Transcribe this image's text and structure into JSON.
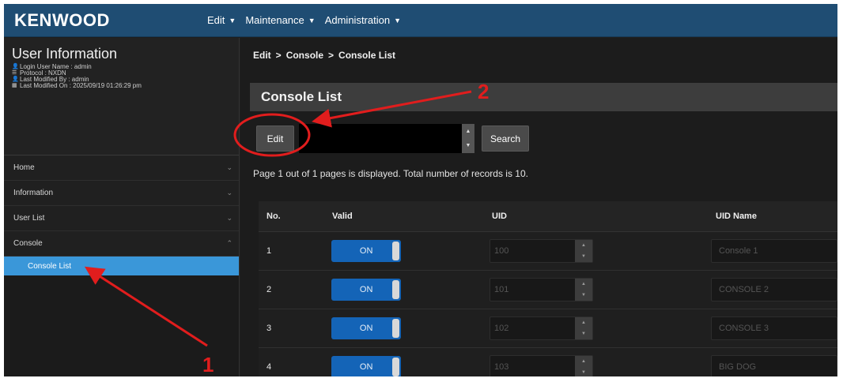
{
  "brand": {
    "name": "KENWOOD"
  },
  "nav": {
    "items": [
      "Edit",
      "Maintenance",
      "Administration"
    ]
  },
  "user_info": {
    "title": "User Information",
    "lines": [
      "Login User Name : admin",
      "Protocol : NXDN",
      "Last Modified By : admin",
      "Last Modified On : 2025/09/19 01:26:29 pm"
    ]
  },
  "sidebar": {
    "items": [
      {
        "label": "Home",
        "chevron": "chevron-down-icon"
      },
      {
        "label": "Information",
        "chevron": "chevron-down-icon"
      },
      {
        "label": "User List",
        "chevron": "chevron-down-icon"
      },
      {
        "label": "Console",
        "chevron": "chevron-up-icon"
      }
    ],
    "active_sub": "Console List"
  },
  "breadcrumb": {
    "items": [
      "Edit",
      "Console",
      "Console List"
    ],
    "separator": ">"
  },
  "section_title": "Console List",
  "toolbar": {
    "edit_label": "Edit",
    "search_value": "",
    "search_label": "Search"
  },
  "page_info": "Page 1 out of 1 pages is displayed. Total number of records is 10.",
  "table": {
    "headers": [
      "No.",
      "Valid",
      "UID",
      "UID Name"
    ],
    "rows": [
      {
        "no": "1",
        "valid": "ON",
        "uid": "100",
        "name": "Console 1"
      },
      {
        "no": "2",
        "valid": "ON",
        "uid": "101",
        "name": "CONSOLE 2"
      },
      {
        "no": "3",
        "valid": "ON",
        "uid": "102",
        "name": "CONSOLE 3"
      },
      {
        "no": "4",
        "valid": "ON",
        "uid": "103",
        "name": "BIG DOG"
      }
    ]
  },
  "annotations": {
    "marker_1": "1",
    "marker_2": "2",
    "color": "#e11d1d"
  },
  "colors": {
    "navbar": "#1f4d73",
    "active_sub": "#3a97d9",
    "toggle_on": "#1464b7"
  }
}
